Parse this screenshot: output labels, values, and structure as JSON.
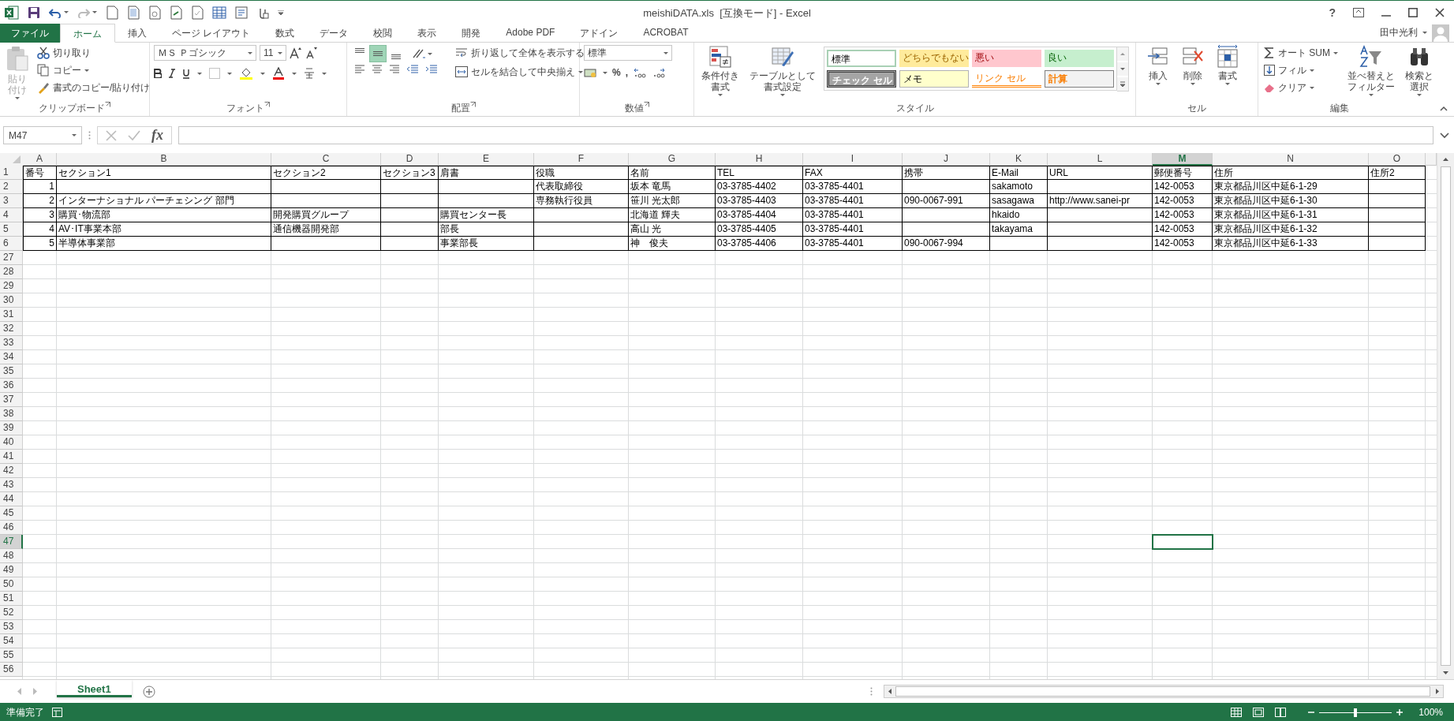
{
  "window": {
    "title": "meishiDATA.xls  [互換モード] - Excel",
    "help": "?",
    "user": "田中光利"
  },
  "tabs": [
    {
      "label": "ファイル",
      "kind": "file",
      "selected": false
    },
    {
      "label": "ホーム",
      "kind": "tab",
      "selected": true
    },
    {
      "label": "挿入",
      "kind": "tab",
      "selected": false
    },
    {
      "label": "ページ レイアウト",
      "kind": "tab",
      "selected": false
    },
    {
      "label": "数式",
      "kind": "tab",
      "selected": false
    },
    {
      "label": "データ",
      "kind": "tab",
      "selected": false
    },
    {
      "label": "校閲",
      "kind": "tab",
      "selected": false
    },
    {
      "label": "表示",
      "kind": "tab",
      "selected": false
    },
    {
      "label": "開発",
      "kind": "tab",
      "selected": false
    },
    {
      "label": "Adobe PDF",
      "kind": "tab",
      "selected": false
    },
    {
      "label": "アドイン",
      "kind": "tab",
      "selected": false
    },
    {
      "label": "ACROBAT",
      "kind": "tab",
      "selected": false
    }
  ],
  "ribbon": {
    "groups": [
      {
        "kind": "clipboard",
        "label": "クリップボード",
        "items": [
          {
            "label": "貼り付け",
            "disabled": true
          },
          {
            "label": "切り取り",
            "disabled": false
          },
          {
            "label": "コピー",
            "disabled": false
          },
          {
            "label": "書式のコピー/貼り付け",
            "disabled": false
          }
        ]
      },
      {
        "kind": "font",
        "label": "フォント",
        "font_name": "ＭＳ Ｐゴシック",
        "font_size": "11"
      },
      {
        "kind": "alignment",
        "label": "配置",
        "vertical_align": [
          {
            "selected": false
          },
          {
            "selected": true
          },
          {
            "selected": false
          }
        ],
        "items": [
          {
            "label": "折り返して全体を表示する"
          },
          {
            "label": "セルを結合して中央揃え"
          }
        ]
      },
      {
        "kind": "number",
        "label": "数値",
        "format": "標準",
        "items": [
          {
            "label": "%"
          },
          {
            "label": ","
          }
        ]
      },
      {
        "kind": "styles",
        "label": "スタイル",
        "items": [
          {
            "label": "条件付き書式"
          },
          {
            "label": "テーブルとして書式設定"
          }
        ],
        "gallery": [
          {
            "label": "標準",
            "kind": "normal"
          },
          {
            "label": "どちらでもない",
            "kind": "neutral"
          },
          {
            "label": "悪い",
            "kind": "bad"
          },
          {
            "label": "良い",
            "kind": "good"
          },
          {
            "label": "チェック セル",
            "kind": "check"
          },
          {
            "label": "メモ",
            "kind": "note"
          },
          {
            "label": "リンク セル",
            "kind": "link"
          },
          {
            "label": "計算",
            "kind": "calc"
          }
        ]
      },
      {
        "kind": "cells",
        "label": "セル",
        "items": [
          {
            "label": "挿入"
          },
          {
            "label": "削除"
          },
          {
            "label": "書式"
          }
        ]
      },
      {
        "kind": "editing",
        "label": "編集",
        "items": [
          {
            "label": "オート SUM"
          },
          {
            "label": "フィル"
          },
          {
            "label": "クリア"
          },
          {
            "label": "並べ替えとフィルター"
          },
          {
            "label": "検索と選択"
          }
        ]
      }
    ]
  },
  "formula_bar": {
    "name_box": "M47",
    "function_label": "fx"
  },
  "grid": {
    "columns": [
      {
        "letter": "A",
        "selected": false
      },
      {
        "letter": "B",
        "selected": false
      },
      {
        "letter": "C",
        "selected": false
      },
      {
        "letter": "D",
        "selected": false
      },
      {
        "letter": "E",
        "selected": false
      },
      {
        "letter": "F",
        "selected": false
      },
      {
        "letter": "G",
        "selected": false
      },
      {
        "letter": "H",
        "selected": false
      },
      {
        "letter": "I",
        "selected": false
      },
      {
        "letter": "J",
        "selected": false
      },
      {
        "letter": "K",
        "selected": false
      },
      {
        "letter": "L",
        "selected": false
      },
      {
        "letter": "M",
        "selected": true
      },
      {
        "letter": "N",
        "selected": false
      },
      {
        "letter": "O",
        "selected": false
      }
    ],
    "rows": [
      {
        "number": "1",
        "selected": false,
        "bordered": true,
        "cells": {
          "A": "番号",
          "B": "セクション1",
          "C": "セクション2",
          "D": "セクション3",
          "E": "肩書",
          "F": "役職",
          "G": "名前",
          "H": "TEL",
          "I": "FAX",
          "J": "携帯",
          "K": "E-Mail",
          "L": "URL",
          "M": "郵便番号",
          "N": "住所",
          "O": "住所2"
        }
      },
      {
        "number": "2",
        "selected": false,
        "bordered": true,
        "cells": {
          "A": "1",
          "F": "代表取締役",
          "G": "坂本 竜馬",
          "H": "03-3785-4402",
          "I": "03-3785-4401",
          "K": "sakamoto",
          "M": "142-0053",
          "N": "東京都品川区中延6-1-29"
        }
      },
      {
        "number": "3",
        "selected": false,
        "bordered": true,
        "cells": {
          "A": "2",
          "B": "インターナショナル パーチェシング 部門",
          "F": "専務執行役員",
          "G": "笹川 光太郎",
          "H": "03-3785-4403",
          "I": "03-3785-4401",
          "J": "090-0067-991",
          "K": "sasagawa",
          "L": "http://www.sanei-pr",
          "M": "142-0053",
          "N": "東京都品川区中延6-1-30"
        }
      },
      {
        "number": "4",
        "selected": false,
        "bordered": true,
        "cells": {
          "A": "3",
          "B": "購買･物流部",
          "C": "開発購買グループ",
          "E": "購買センター長",
          "G": "北海道 輝夫",
          "H": "03-3785-4404",
          "I": "03-3785-4401",
          "K": "hkaido",
          "M": "142-0053",
          "N": "東京都品川区中延6-1-31"
        }
      },
      {
        "number": "5",
        "selected": false,
        "bordered": true,
        "cells": {
          "A": "4",
          "B": "AV･IT事業本部",
          "C": "通信機器開発部",
          "E": "部長",
          "G": "高山 光",
          "H": "03-3785-4405",
          "I": "03-3785-4401",
          "K": "takayama",
          "M": "142-0053",
          "N": "東京都品川区中延6-1-32"
        }
      },
      {
        "number": "6",
        "selected": false,
        "bordered": true,
        "cells": {
          "A": "5",
          "B": "半導体事業部",
          "E": "事業部長",
          "G": "神　俊夫",
          "H": "03-3785-4406",
          "I": "03-3785-4401",
          "J": "090-0067-994",
          "M": "142-0053",
          "N": "東京都品川区中延6-1-33"
        }
      },
      {
        "number": "27",
        "selected": false,
        "bordered": false
      },
      {
        "number": "28",
        "selected": false,
        "bordered": false
      },
      {
        "number": "29",
        "selected": false,
        "bordered": false
      },
      {
        "number": "30",
        "selected": false,
        "bordered": false
      },
      {
        "number": "31",
        "selected": false,
        "bordered": false
      },
      {
        "number": "32",
        "selected": false,
        "bordered": false
      },
      {
        "number": "33",
        "selected": false,
        "bordered": false
      },
      {
        "number": "34",
        "selected": false,
        "bordered": false
      },
      {
        "number": "35",
        "selected": false,
        "bordered": false
      },
      {
        "number": "36",
        "selected": false,
        "bordered": false
      },
      {
        "number": "37",
        "selected": false,
        "bordered": false
      },
      {
        "number": "38",
        "selected": false,
        "bordered": false
      },
      {
        "number": "39",
        "selected": false,
        "bordered": false
      },
      {
        "number": "40",
        "selected": false,
        "bordered": false
      },
      {
        "number": "41",
        "selected": false,
        "bordered": false
      },
      {
        "number": "42",
        "selected": false,
        "bordered": false
      },
      {
        "number": "43",
        "selected": false,
        "bordered": false
      },
      {
        "number": "44",
        "selected": false,
        "bordered": false
      },
      {
        "number": "45",
        "selected": false,
        "bordered": false
      },
      {
        "number": "46",
        "selected": false,
        "bordered": false
      },
      {
        "number": "47",
        "selected": true,
        "bordered": false
      },
      {
        "number": "48",
        "selected": false,
        "bordered": false
      },
      {
        "number": "49",
        "selected": false,
        "bordered": false
      },
      {
        "number": "50",
        "selected": false,
        "bordered": false
      },
      {
        "number": "51",
        "selected": false,
        "bordered": false
      },
      {
        "number": "52",
        "selected": false,
        "bordered": false
      },
      {
        "number": "53",
        "selected": false,
        "bordered": false
      },
      {
        "number": "54",
        "selected": false,
        "bordered": false
      },
      {
        "number": "55",
        "selected": false,
        "bordered": false
      },
      {
        "number": "56",
        "selected": false,
        "bordered": false
      }
    ]
  },
  "sheets": [
    {
      "label": "Sheet1",
      "selected": true
    }
  ],
  "status_bar": {
    "status": "準備完了",
    "zoom": "100%",
    "zoom_slider": {
      "level": 0.5
    }
  }
}
